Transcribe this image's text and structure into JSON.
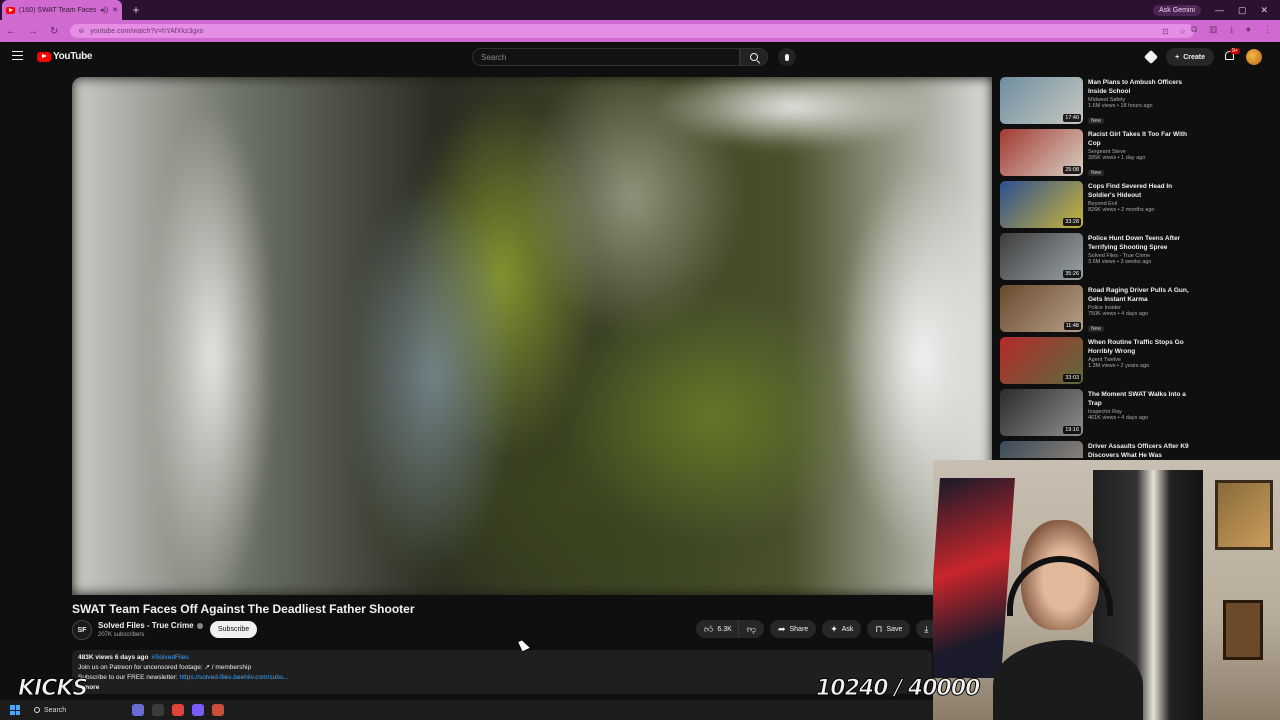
{
  "browser": {
    "tab_title": "(160) SWAT Team Faces Off",
    "new_tab": "+",
    "ask_gemini": "Ask Gemini",
    "url": "youtube.com/watch?v=hYAfXkz3gxo",
    "window_controls": [
      "—",
      "▢",
      "✕"
    ]
  },
  "youtube": {
    "logo_text": "YouTube",
    "search_placeholder": "Search",
    "create_label": "Create",
    "notification_count": "9+"
  },
  "video": {
    "title": "SWAT Team Faces Off Against The Deadliest Father Shooter",
    "channel_initials": "SF",
    "channel_name": "Solved Files - True Crime",
    "subscribers": "207K subscribers",
    "subscribe_label": "Subscribe",
    "likes": "6.3K",
    "share_label": "Share",
    "ask_label": "Ask",
    "save_label": "Save",
    "download_label": "D",
    "desc_meta": "483K views  6 days ago",
    "desc_tag": "#SolvedFiles",
    "desc_line1": "Join us on Patreon for uncensored footage: ↗ / membership",
    "desc_line2_prefix": "Subscribe to our FREE newsletter: ",
    "desc_line2_link": "https://solved-files.beehiiv.com/subs...",
    "desc_more": "...more"
  },
  "recommendations": [
    {
      "title": "Man Plans to Ambush Officers Inside School",
      "channel": "Midwest Safety",
      "stats": "1.6M views • 18 hours ago",
      "badge": "New",
      "duration": "17:40",
      "color1": "#6f8ea0",
      "color2": "#c7c8c2"
    },
    {
      "title": "Racist Girl Takes It Too Far With Cop",
      "channel": "Sergeant Steve",
      "stats": "395K views • 1 day ago",
      "badge": "New",
      "duration": "25:08",
      "color1": "#a23a34",
      "color2": "#d8cfc2"
    },
    {
      "title": "Cops Find Severed Head In Soldier's Hideout",
      "channel": "Beyond Evil",
      "stats": "826K views • 2 months ago",
      "badge": "",
      "duration": "33:28",
      "color1": "#2c4f8f",
      "color2": "#c9b43a"
    },
    {
      "title": "Police Hunt Down Teens After Terrifying Shooting Spree",
      "channel": "Solved Files - True Crime",
      "stats": "3.6M views • 3 weeks ago",
      "badge": "",
      "duration": "35:26",
      "color1": "#3d3d3d",
      "color2": "#9aa3a8"
    },
    {
      "title": "Road Raging Driver Pulls A Gun, Gets Instant Karma",
      "channel": "Police Insider",
      "stats": "750K views • 4 days ago",
      "badge": "New",
      "duration": "11:48",
      "color1": "#6a4a2e",
      "color2": "#b5a089"
    },
    {
      "title": "When Routine Traffic Stops Go Horribly Wrong",
      "channel": "Agent Twelve",
      "stats": "1.3M views • 2 years ago",
      "badge": "",
      "duration": "33:03",
      "color1": "#b62a2a",
      "color2": "#5a6b3c"
    },
    {
      "title": "The Moment SWAT Walks Into a Trap",
      "channel": "Inspector Ray",
      "stats": "461K views • 4 days ago",
      "badge": "",
      "duration": "19:16",
      "color1": "#2c2c2c",
      "color2": "#8e8e8e"
    },
    {
      "title": "Driver Assaults Officers After K9 Discovers What He Was",
      "channel": "",
      "stats": "",
      "badge": "",
      "duration": "",
      "color1": "#3a4a5a",
      "color2": "#a09080"
    }
  ],
  "overlay": {
    "kicks": "KICKS",
    "counter": "10240 / 40000"
  },
  "taskbar": {
    "search_label": "Search",
    "apps": [
      "#6b6bd6",
      "#3c3c3c",
      "#e0433a",
      "#7a5cff",
      "#c94e3a"
    ]
  }
}
